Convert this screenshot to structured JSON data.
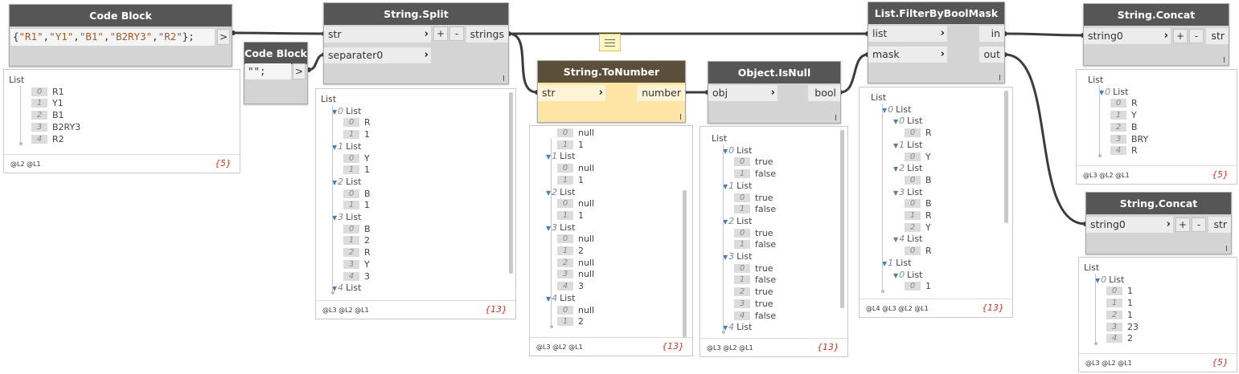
{
  "nodes": {
    "code_block_1": {
      "title": "Code Block",
      "code_parts": [
        "{",
        "\"R1\"",
        ",",
        "\"Y1\"",
        ",",
        "\"B1\"",
        ",",
        "\"B2RY3\"",
        ",",
        "\"R2\"",
        "};"
      ],
      "out_arrow": ">"
    },
    "code_block_2": {
      "title": "Code Block",
      "code": "\"\";",
      "out_arrow": ">"
    },
    "string_split": {
      "title": "String.Split",
      "inputs": [
        "str",
        "separater0"
      ],
      "plus": "+",
      "minus": "-",
      "output": "strings"
    },
    "string_to_number": {
      "title": "String.ToNumber",
      "input": "str",
      "output": "number"
    },
    "object_isnull": {
      "title": "Object.IsNull",
      "input": "obj",
      "output": "bool"
    },
    "filter_bool_mask": {
      "title": "List.FilterByBoolMask",
      "inputs": [
        "list",
        "mask"
      ],
      "outputs": [
        "in",
        "out"
      ]
    },
    "string_concat_1": {
      "title": "String.Concat",
      "input": "string0",
      "plus": "+",
      "minus": "-",
      "output": "str"
    },
    "string_concat_2": {
      "title": "String.Concat",
      "input": "string0",
      "plus": "+",
      "minus": "-",
      "output": "str"
    }
  },
  "watches": {
    "w1": {
      "levels": "@L2 @L1",
      "count": "{5}",
      "rows": [
        {
          "t": "head",
          "label": "List"
        },
        {
          "t": "item",
          "idx": "0",
          "v": "R1"
        },
        {
          "t": "item",
          "idx": "1",
          "v": "Y1"
        },
        {
          "t": "item",
          "idx": "2",
          "v": "B1"
        },
        {
          "t": "item",
          "idx": "3",
          "v": "B2RY3"
        },
        {
          "t": "item",
          "idx": "4",
          "v": "R2"
        }
      ]
    },
    "w2": {
      "levels": "@L3 @L2 @L1",
      "count": "{13}",
      "rows": [
        {
          "t": "head",
          "label": "List"
        },
        {
          "t": "sub",
          "n": "0",
          "label": "List"
        },
        {
          "t": "item",
          "idx": "0",
          "v": "R"
        },
        {
          "t": "item",
          "idx": "1",
          "v": "1"
        },
        {
          "t": "sub",
          "n": "1",
          "label": "List"
        },
        {
          "t": "item",
          "idx": "0",
          "v": "Y"
        },
        {
          "t": "item",
          "idx": "1",
          "v": "1"
        },
        {
          "t": "sub",
          "n": "2",
          "label": "List"
        },
        {
          "t": "item",
          "idx": "0",
          "v": "B"
        },
        {
          "t": "item",
          "idx": "1",
          "v": "1"
        },
        {
          "t": "sub",
          "n": "3",
          "label": "List"
        },
        {
          "t": "item",
          "idx": "0",
          "v": "B"
        },
        {
          "t": "item",
          "idx": "1",
          "v": "2"
        },
        {
          "t": "item",
          "idx": "2",
          "v": "R"
        },
        {
          "t": "item",
          "idx": "3",
          "v": "Y"
        },
        {
          "t": "item",
          "idx": "4",
          "v": "3"
        },
        {
          "t": "sub",
          "n": "4",
          "label": "List"
        }
      ]
    },
    "w3": {
      "levels": "@L3 @L2 @L1",
      "count": "{13}",
      "rows": [
        {
          "t": "item",
          "idx": "0",
          "v": "null"
        },
        {
          "t": "item",
          "idx": "1",
          "v": "1"
        },
        {
          "t": "sub",
          "n": "1",
          "label": "List"
        },
        {
          "t": "item",
          "idx": "0",
          "v": "null"
        },
        {
          "t": "item",
          "idx": "1",
          "v": "1"
        },
        {
          "t": "sub",
          "n": "2",
          "label": "List"
        },
        {
          "t": "item",
          "idx": "0",
          "v": "null"
        },
        {
          "t": "item",
          "idx": "1",
          "v": "1"
        },
        {
          "t": "sub",
          "n": "3",
          "label": "List"
        },
        {
          "t": "item",
          "idx": "0",
          "v": "null"
        },
        {
          "t": "item",
          "idx": "1",
          "v": "2"
        },
        {
          "t": "item",
          "idx": "2",
          "v": "null"
        },
        {
          "t": "item",
          "idx": "3",
          "v": "null"
        },
        {
          "t": "item",
          "idx": "4",
          "v": "3"
        },
        {
          "t": "sub",
          "n": "4",
          "label": "List"
        },
        {
          "t": "item",
          "idx": "0",
          "v": "null"
        },
        {
          "t": "item",
          "idx": "1",
          "v": "2"
        }
      ]
    },
    "w4": {
      "levels": "@L3 @L2 @L1",
      "count": "{13}",
      "rows": [
        {
          "t": "head",
          "label": "List"
        },
        {
          "t": "sub",
          "n": "0",
          "label": "List"
        },
        {
          "t": "item",
          "idx": "0",
          "v": "true"
        },
        {
          "t": "item",
          "idx": "1",
          "v": "false"
        },
        {
          "t": "sub",
          "n": "1",
          "label": "List"
        },
        {
          "t": "item",
          "idx": "0",
          "v": "true"
        },
        {
          "t": "item",
          "idx": "1",
          "v": "false"
        },
        {
          "t": "sub",
          "n": "2",
          "label": "List"
        },
        {
          "t": "item",
          "idx": "0",
          "v": "true"
        },
        {
          "t": "item",
          "idx": "1",
          "v": "false"
        },
        {
          "t": "sub",
          "n": "3",
          "label": "List"
        },
        {
          "t": "item",
          "idx": "0",
          "v": "true"
        },
        {
          "t": "item",
          "idx": "1",
          "v": "false"
        },
        {
          "t": "item",
          "idx": "2",
          "v": "true"
        },
        {
          "t": "item",
          "idx": "3",
          "v": "true"
        },
        {
          "t": "item",
          "idx": "4",
          "v": "false"
        },
        {
          "t": "sub",
          "n": "4",
          "label": "List"
        }
      ]
    },
    "w5": {
      "levels": "@L4 @L3 @L2 @L1",
      "count": "{13}",
      "rows": [
        {
          "t": "head",
          "label": "List"
        },
        {
          "t": "sub",
          "n": "0",
          "label": "List"
        },
        {
          "t": "sub2",
          "n": "0",
          "label": "List"
        },
        {
          "t": "item2",
          "idx": "0",
          "v": "R"
        },
        {
          "t": "sub2",
          "n": "1",
          "label": "List"
        },
        {
          "t": "item2",
          "idx": "0",
          "v": "Y"
        },
        {
          "t": "sub2",
          "n": "2",
          "label": "List"
        },
        {
          "t": "item2",
          "idx": "0",
          "v": "B"
        },
        {
          "t": "sub2",
          "n": "3",
          "label": "List"
        },
        {
          "t": "item2",
          "idx": "0",
          "v": "B"
        },
        {
          "t": "item2",
          "idx": "1",
          "v": "R"
        },
        {
          "t": "item2",
          "idx": "2",
          "v": "Y"
        },
        {
          "t": "sub2",
          "n": "4",
          "label": "List"
        },
        {
          "t": "item2",
          "idx": "0",
          "v": "R"
        },
        {
          "t": "sub",
          "n": "1",
          "label": "List"
        },
        {
          "t": "sub2",
          "n": "0",
          "label": "List"
        },
        {
          "t": "item2",
          "idx": "0",
          "v": "1"
        }
      ]
    },
    "w6": {
      "levels": "@L3 @L2 @L1",
      "count": "{5}",
      "rows": [
        {
          "t": "head",
          "label": "List"
        },
        {
          "t": "sub",
          "n": "0",
          "label": "List"
        },
        {
          "t": "item",
          "idx": "0",
          "v": "R"
        },
        {
          "t": "item",
          "idx": "1",
          "v": "Y"
        },
        {
          "t": "item",
          "idx": "2",
          "v": "B"
        },
        {
          "t": "item",
          "idx": "3",
          "v": "BRY"
        },
        {
          "t": "item",
          "idx": "4",
          "v": "R"
        }
      ]
    },
    "w7": {
      "levels": "@L3 @L2 @L1",
      "count": "{5}",
      "rows": [
        {
          "t": "head",
          "label": "List"
        },
        {
          "t": "sub",
          "n": "0",
          "label": "List"
        },
        {
          "t": "item",
          "idx": "0",
          "v": "1"
        },
        {
          "t": "item",
          "idx": "1",
          "v": "1"
        },
        {
          "t": "item",
          "idx": "2",
          "v": "1"
        },
        {
          "t": "item",
          "idx": "3",
          "v": "23"
        },
        {
          "t": "item",
          "idx": "4",
          "v": "2"
        }
      ]
    }
  }
}
